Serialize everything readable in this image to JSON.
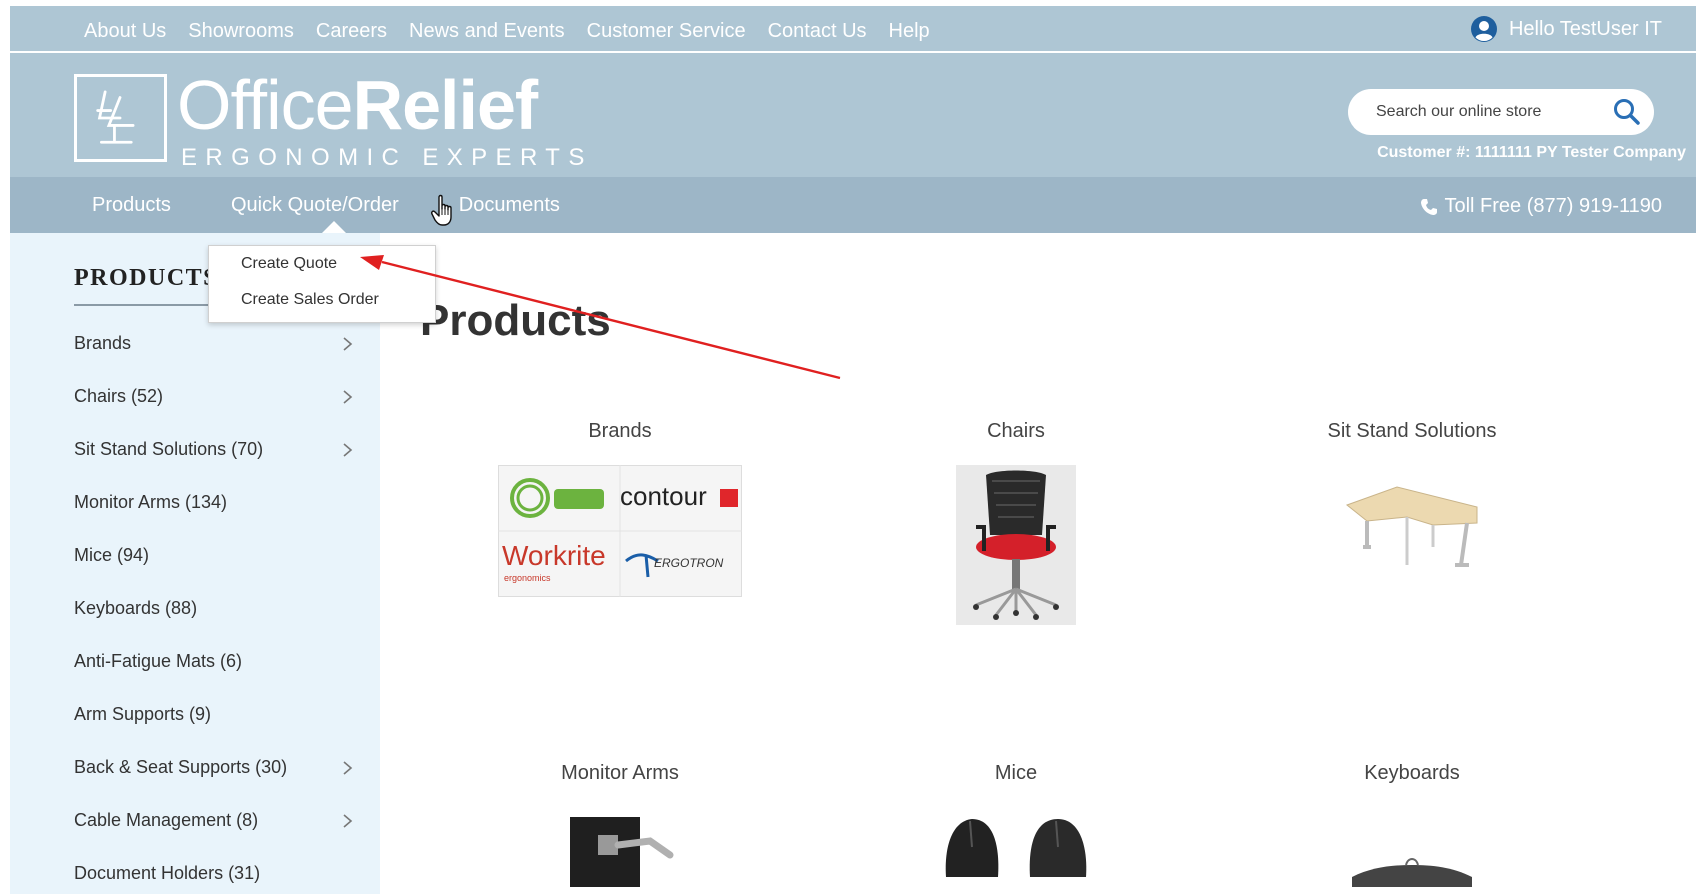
{
  "topbar": {
    "links": [
      "About Us",
      "Showrooms",
      "Careers",
      "News and Events",
      "Customer Service",
      "Contact Us",
      "Help"
    ],
    "greeting": "Hello TestUser IT",
    "user_icon": "user-circle-icon"
  },
  "header": {
    "logo_light": "Office",
    "logo_bold": "Relief",
    "logo_tagline": "ERGONOMIC EXPERTS",
    "search_placeholder": "Search our online store",
    "search_icon": "search-icon",
    "customer_number": "Customer #: 1111111 PY Tester Company"
  },
  "nav": {
    "items": [
      "Products",
      "Quick Quote/Order",
      "Documents"
    ],
    "toll_free": "Toll Free (877) 919-1190",
    "phone_icon": "phone-icon"
  },
  "dropdown": {
    "items": [
      "Create Quote",
      "Create Sales Order"
    ]
  },
  "sidebar": {
    "title": "PRODUCTS",
    "items": [
      {
        "label": "Brands",
        "has_children": true
      },
      {
        "label": "Chairs (52)",
        "has_children": true
      },
      {
        "label": "Sit Stand Solutions (70)",
        "has_children": true
      },
      {
        "label": "Monitor Arms (134)",
        "has_children": false
      },
      {
        "label": "Mice (94)",
        "has_children": false
      },
      {
        "label": "Keyboards (88)",
        "has_children": false
      },
      {
        "label": "Anti-Fatigue Mats (6)",
        "has_children": false
      },
      {
        "label": "Arm Supports (9)",
        "has_children": false
      },
      {
        "label": "Back & Seat Supports (30)",
        "has_children": true
      },
      {
        "label": "Cable Management (8)",
        "has_children": true
      },
      {
        "label": "Document Holders (31)",
        "has_children": false
      }
    ]
  },
  "main": {
    "title": "Products",
    "tiles": [
      "Brands",
      "Chairs",
      "Sit Stand Solutions",
      "Monitor Arms",
      "Mice",
      "Keyboards"
    ],
    "brand_logos": [
      "contour",
      "Workrite",
      "ergonomics",
      "ERGOTRON"
    ]
  },
  "colors": {
    "header_bg": "#aec6d4",
    "nav_bg": "#9db6c7",
    "sidebar_bg": "#e9f4fb",
    "annotation_arrow": "#e02020",
    "chair_seat": "#d4202a",
    "om_logo": "#6cb33f"
  }
}
